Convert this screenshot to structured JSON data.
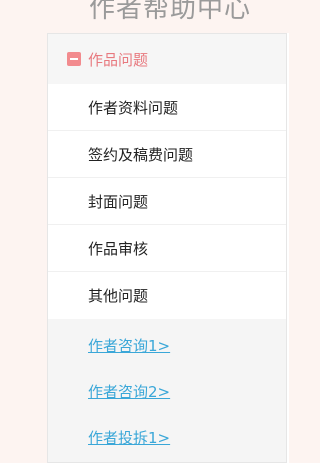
{
  "header": {
    "title": "作者帮助中心"
  },
  "category": {
    "label": "作品问题",
    "icon": "collapse-icon",
    "accent_color": "#e8797f",
    "items": [
      {
        "label": "作者资料问题"
      },
      {
        "label": "签约及稿费问题"
      },
      {
        "label": "封面问题"
      },
      {
        "label": "作品审核"
      },
      {
        "label": "其他问题"
      }
    ]
  },
  "contacts": {
    "link_color": "#3aa7d8",
    "links": [
      {
        "label": "作者咨询1>"
      },
      {
        "label": "作者咨询2>"
      },
      {
        "label": "作者投拆1>"
      }
    ]
  }
}
